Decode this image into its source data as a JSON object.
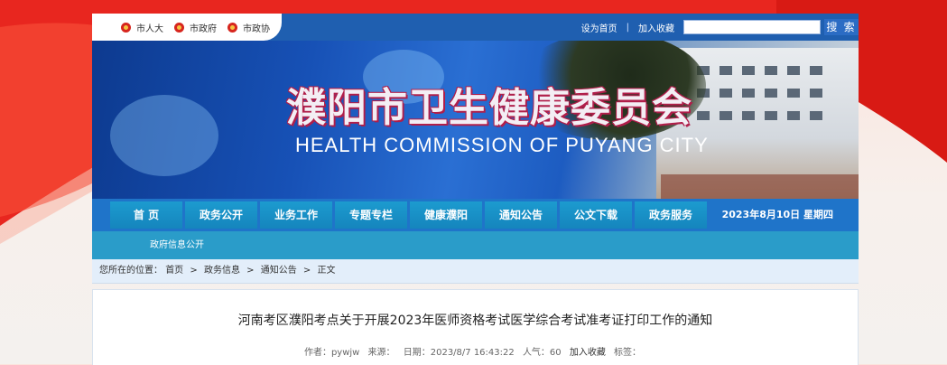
{
  "top": {
    "links": [
      {
        "label": "市人大"
      },
      {
        "label": "市政府"
      },
      {
        "label": "市政协"
      }
    ],
    "set_home": "设为首页",
    "separator": "|",
    "add_fav": "加入收藏",
    "search_placeholder": "",
    "search_btn": "搜 索"
  },
  "banner": {
    "title": "濮阳市卫生健康委员会",
    "subtitle": "HEALTH  COMMISSION OF PUYANG CITY"
  },
  "nav": {
    "items": [
      {
        "label": "首  页"
      },
      {
        "label": "政务公开"
      },
      {
        "label": "业务工作"
      },
      {
        "label": "专题专栏"
      },
      {
        "label": "健康濮阳"
      },
      {
        "label": "通知公告"
      },
      {
        "label": "公文下载"
      },
      {
        "label": "政务服务"
      }
    ],
    "date": "2023年8月10日  星期四"
  },
  "subnav": {
    "label": "政府信息公开"
  },
  "breadcrumb": {
    "prefix": "您所在的位置：",
    "items": [
      "首页",
      "政务信息",
      "通知公告",
      "正文"
    ],
    "sep": ">"
  },
  "article": {
    "title": "河南考区濮阳考点关于开展2023年医师资格考试医学综合考试准考证打印工作的通知",
    "author": "作者：pywjw",
    "source": "来源：",
    "date": "日期：2023/8/7 16:43:22",
    "views": "人气：60",
    "add_fav": "加入收藏",
    "tags": "标签："
  },
  "colors": {
    "nav_bg": "#1f74c9",
    "nav_item": "#1c9bcf",
    "subnav": "#2a9cc9",
    "title_outline": "#b01e4a"
  }
}
